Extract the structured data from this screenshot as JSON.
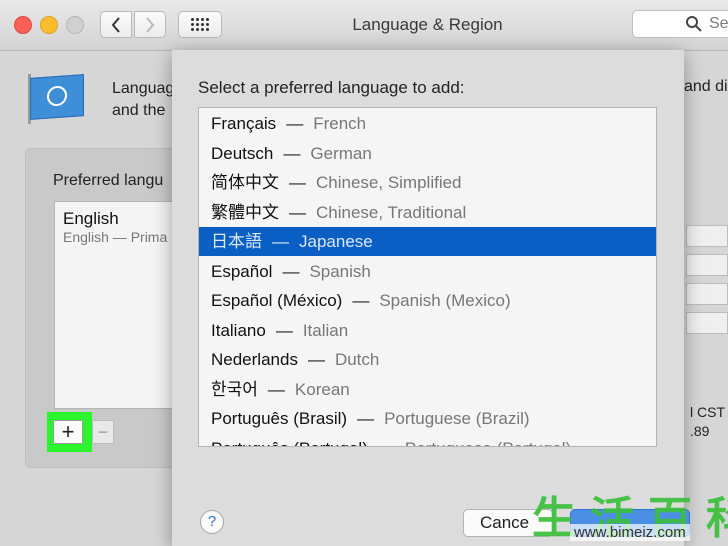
{
  "window": {
    "title": "Language & Region",
    "search_placeholder": "Se"
  },
  "background": {
    "description_line1": "Languag",
    "description_line2": "and the",
    "description_right": "and di",
    "preferred_label": "Preferred langu",
    "languages": [
      {
        "name": "English",
        "subtitle": "English — Prima"
      }
    ],
    "add_label": "+",
    "remove_label": "−",
    "right_text_1": "l CST",
    "right_text_2": ".89"
  },
  "sheet": {
    "title": "Select a preferred language to add:",
    "languages": [
      {
        "native": "Français",
        "english": "French",
        "selected": false
      },
      {
        "native": "Deutsch",
        "english": "German",
        "selected": false
      },
      {
        "native": "简体中文",
        "english": "Chinese, Simplified",
        "selected": false
      },
      {
        "native": "繁體中文",
        "english": "Chinese, Traditional",
        "selected": false
      },
      {
        "native": "日本語",
        "english": "Japanese",
        "selected": true
      },
      {
        "native": "Español",
        "english": "Spanish",
        "selected": false
      },
      {
        "native": "Español (México)",
        "english": "Spanish (Mexico)",
        "selected": false
      },
      {
        "native": "Italiano",
        "english": "Italian",
        "selected": false
      },
      {
        "native": "Nederlands",
        "english": "Dutch",
        "selected": false
      },
      {
        "native": "한국어",
        "english": "Korean",
        "selected": false
      },
      {
        "native": "Português (Brasil)",
        "english": "Portuguese (Brazil)",
        "selected": false
      },
      {
        "native": "Português (Portugal)",
        "english": "Portuguese (Portugal)",
        "selected": false
      }
    ],
    "dash": "—",
    "help_label": "?",
    "cancel_label": "Cance"
  },
  "watermark": {
    "chars": "生活百科",
    "url": "www.bimeiz.com"
  }
}
